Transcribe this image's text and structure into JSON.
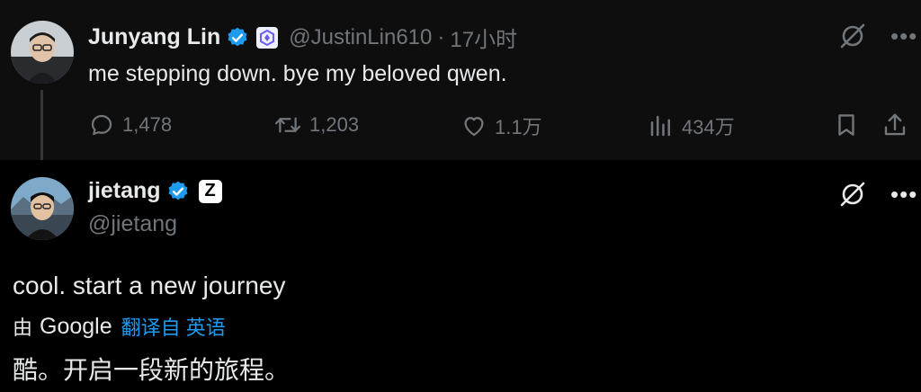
{
  "tweet1": {
    "display_name": "Junyang Lin",
    "handle": "@JustinLin610",
    "separator": "·",
    "time": "17小时",
    "text": "me stepping down. bye my beloved qwen.",
    "replies": "1,478",
    "retweets": "1,203",
    "likes": "1.1万",
    "views": "434万"
  },
  "tweet2": {
    "display_name": "jietang",
    "badge_letter": "Z",
    "handle": "@jietang",
    "text": "cool. start a new journey",
    "translated_by": "由",
    "translator": "Google",
    "translate_link": "翻译自 英语",
    "translation": "酷。开启一段新的旅程。"
  },
  "colors": {
    "background": "#000000",
    "card_bg": "#0e0e0f",
    "text": "#e7e9ea",
    "muted": "#71767b",
    "accent": "#1d9bf0"
  },
  "icons": [
    "verified-icon",
    "affiliate-badge-icon",
    "grok-icon",
    "more-icon",
    "reply-icon",
    "retweet-icon",
    "like-icon",
    "views-icon",
    "bookmark-icon",
    "share-icon"
  ]
}
